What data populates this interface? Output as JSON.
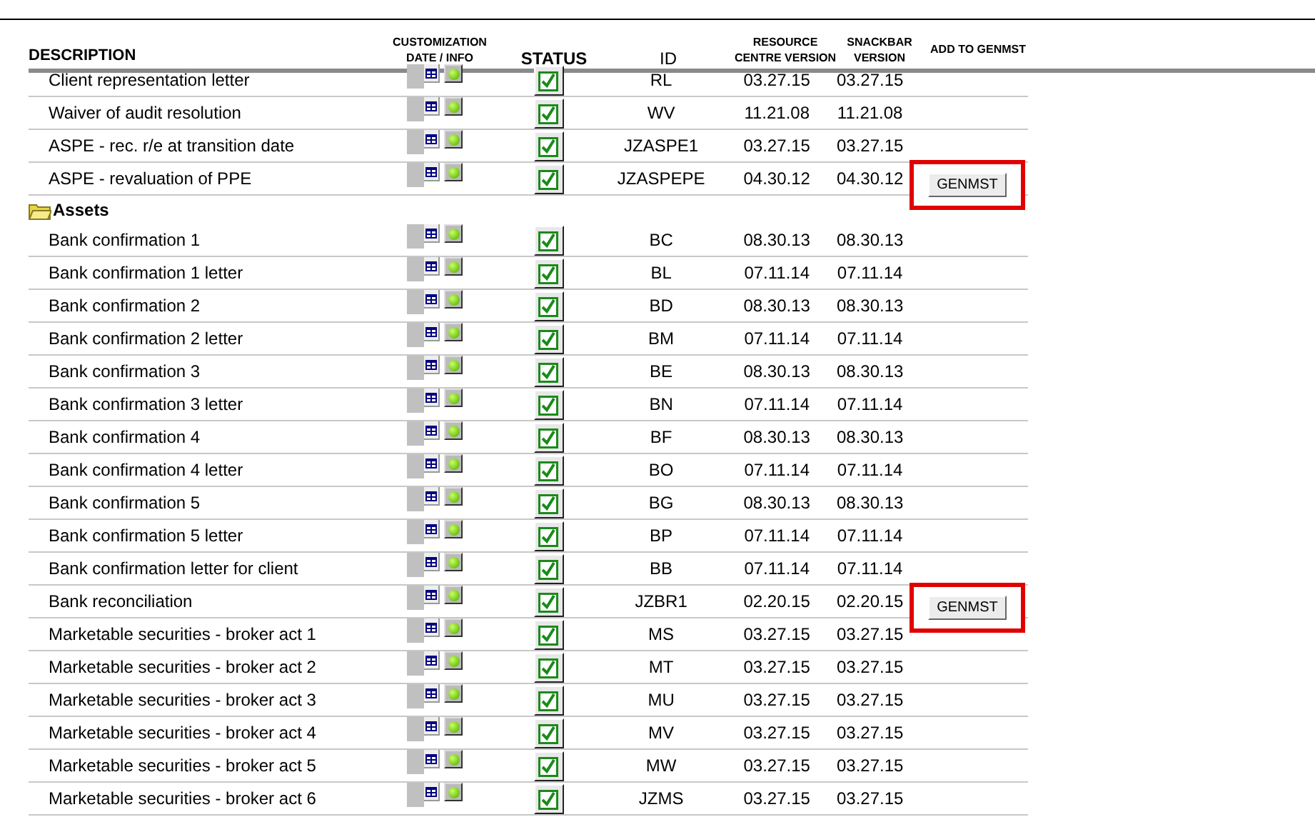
{
  "columns": [
    "DESCRIPTION",
    "CUSTOMIZATION DATE / INFO",
    "STATUS",
    "ID",
    "RESOURCE CENTRE VERSION",
    "SNACKBAR VERSION",
    "ADD TO GENMST"
  ],
  "sections": [
    {
      "rows": [
        {
          "description": "Client representation letter",
          "status_checked": true,
          "id": "RL",
          "resource_centre_version": "03.27.15",
          "snackbar_version": "03.27.15"
        },
        {
          "description": "Waiver of audit resolution",
          "status_checked": true,
          "id": "WV",
          "resource_centre_version": "11.21.08",
          "snackbar_version": "11.21.08"
        },
        {
          "description": "ASPE - rec. r/e at transition date",
          "status_checked": true,
          "id": "JZASPE1",
          "resource_centre_version": "03.27.15",
          "snackbar_version": "03.27.15"
        },
        {
          "description": "ASPE - revaluation of PPE",
          "status_checked": true,
          "id": "JZASPEPE",
          "resource_centre_version": "04.30.12",
          "snackbar_version": "04.30.12",
          "button": "GENMST",
          "highlighted": true
        }
      ]
    },
    {
      "title": "Assets",
      "rows": [
        {
          "description": "Bank confirmation 1",
          "status_checked": true,
          "id": "BC",
          "resource_centre_version": "08.30.13",
          "snackbar_version": "08.30.13"
        },
        {
          "description": "Bank confirmation 1 letter",
          "status_checked": true,
          "id": "BL",
          "resource_centre_version": "07.11.14",
          "snackbar_version": "07.11.14"
        },
        {
          "description": "Bank confirmation 2",
          "status_checked": true,
          "id": "BD",
          "resource_centre_version": "08.30.13",
          "snackbar_version": "08.30.13"
        },
        {
          "description": "Bank confirmation 2 letter",
          "status_checked": true,
          "id": "BM",
          "resource_centre_version": "07.11.14",
          "snackbar_version": "07.11.14"
        },
        {
          "description": "Bank confirmation 3",
          "status_checked": true,
          "id": "BE",
          "resource_centre_version": "08.30.13",
          "snackbar_version": "08.30.13"
        },
        {
          "description": "Bank confirmation 3 letter",
          "status_checked": true,
          "id": "BN",
          "resource_centre_version": "07.11.14",
          "snackbar_version": "07.11.14"
        },
        {
          "description": "Bank confirmation 4",
          "status_checked": true,
          "id": "BF",
          "resource_centre_version": "08.30.13",
          "snackbar_version": "08.30.13"
        },
        {
          "description": "Bank confirmation 4 letter",
          "status_checked": true,
          "id": "BO",
          "resource_centre_version": "07.11.14",
          "snackbar_version": "07.11.14"
        },
        {
          "description": "Bank confirmation 5",
          "status_checked": true,
          "id": "BG",
          "resource_centre_version": "08.30.13",
          "snackbar_version": "08.30.13"
        },
        {
          "description": "Bank confirmation 5 letter",
          "status_checked": true,
          "id": "BP",
          "resource_centre_version": "07.11.14",
          "snackbar_version": "07.11.14"
        },
        {
          "description": "Bank confirmation letter for client",
          "status_checked": true,
          "id": "BB",
          "resource_centre_version": "07.11.14",
          "snackbar_version": "07.11.14"
        },
        {
          "description": "Bank reconciliation",
          "status_checked": true,
          "id": "JZBR1",
          "resource_centre_version": "02.20.15",
          "snackbar_version": "02.20.15",
          "button": "GENMST",
          "highlighted": true
        },
        {
          "description": "Marketable securities - broker act 1",
          "status_checked": true,
          "id": "MS",
          "resource_centre_version": "03.27.15",
          "snackbar_version": "03.27.15"
        },
        {
          "description": "Marketable securities - broker act 2",
          "status_checked": true,
          "id": "MT",
          "resource_centre_version": "03.27.15",
          "snackbar_version": "03.27.15"
        },
        {
          "description": "Marketable securities - broker act 3",
          "status_checked": true,
          "id": "MU",
          "resource_centre_version": "03.27.15",
          "snackbar_version": "03.27.15"
        },
        {
          "description": "Marketable securities - broker act 4",
          "status_checked": true,
          "id": "MV",
          "resource_centre_version": "03.27.15",
          "snackbar_version": "03.27.15"
        },
        {
          "description": "Marketable securities - broker act 5",
          "status_checked": true,
          "id": "MW",
          "resource_centre_version": "03.27.15",
          "snackbar_version": "03.27.15"
        },
        {
          "description": "Marketable securities - broker act 6",
          "status_checked": true,
          "id": "JZMS",
          "resource_centre_version": "03.27.15",
          "snackbar_version": "03.27.15"
        }
      ]
    }
  ]
}
